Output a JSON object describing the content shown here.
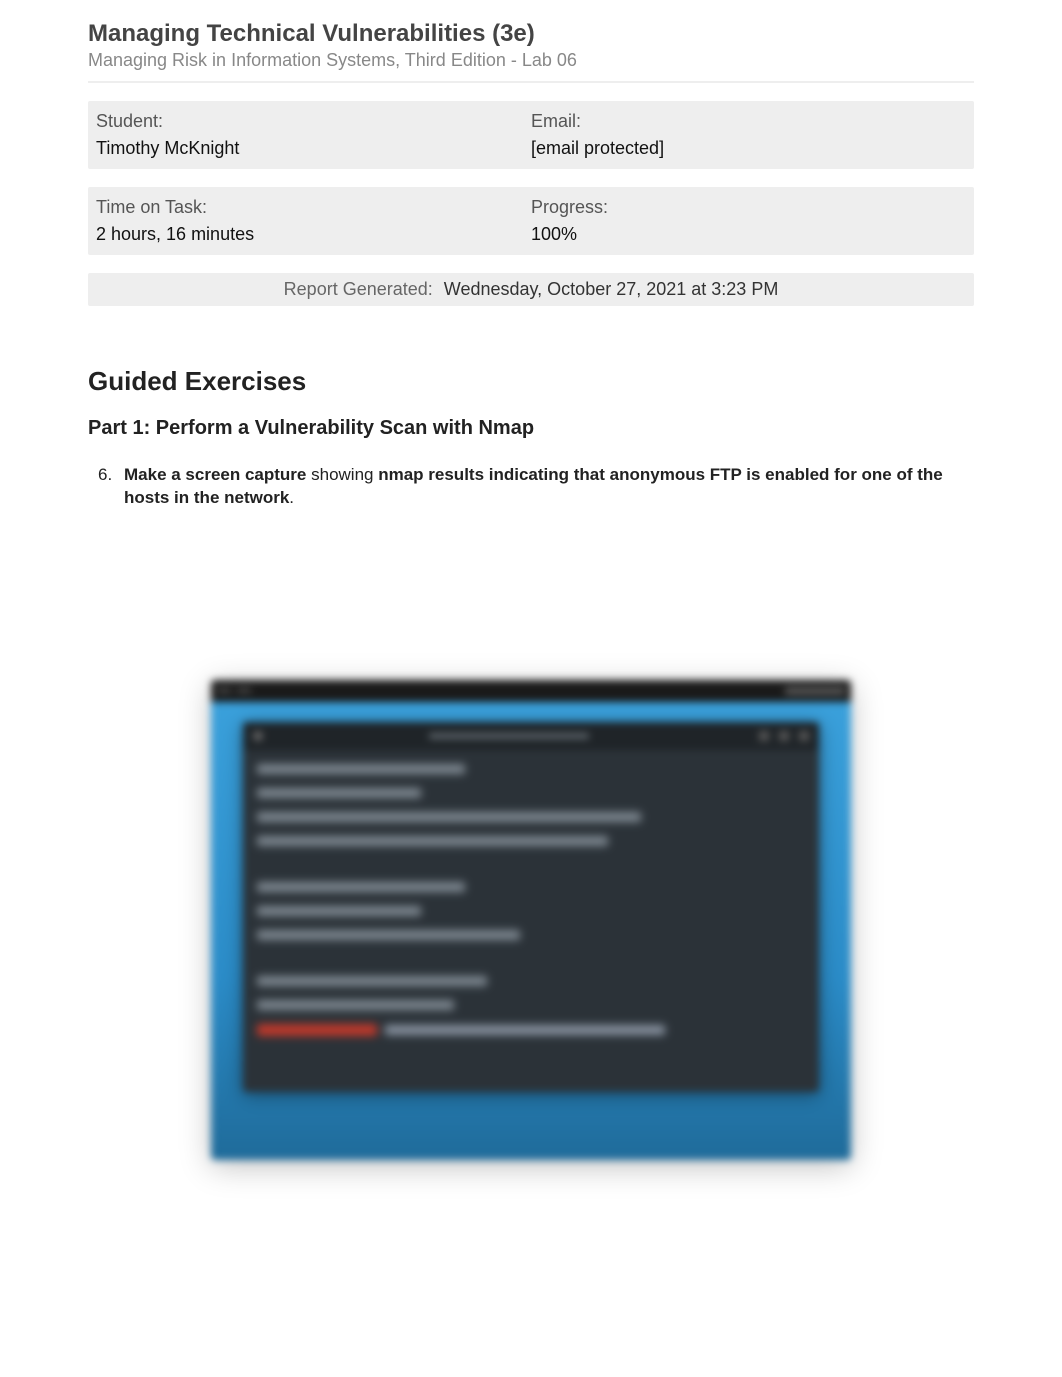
{
  "header": {
    "title": "Managing Technical Vulnerabilities (3e)",
    "subtitle": "Managing Risk in Information Systems, Third Edition - Lab 06"
  },
  "info": {
    "student_label": "Student:",
    "student_value": "Timothy McKnight",
    "email_label": "Email:",
    "email_value": "[email protected]",
    "time_label": "Time on Task:",
    "time_value": "2 hours, 16 minutes",
    "progress_label": "Progress:",
    "progress_value": "100%"
  },
  "report": {
    "label": "Report Generated:",
    "value": "Wednesday, October 27, 2021 at 3:23 PM"
  },
  "section": {
    "heading": "Guided Exercises",
    "part_heading": "Part 1: Perform a Vulnerability Scan with Nmap"
  },
  "exercise": {
    "number": "6.",
    "bold_pre": "Make a screen capture",
    "mid": " showing ",
    "bold_post": "nmap results indicating that anonymous FTP is enabled for one of the hosts in the network",
    "period": "."
  }
}
